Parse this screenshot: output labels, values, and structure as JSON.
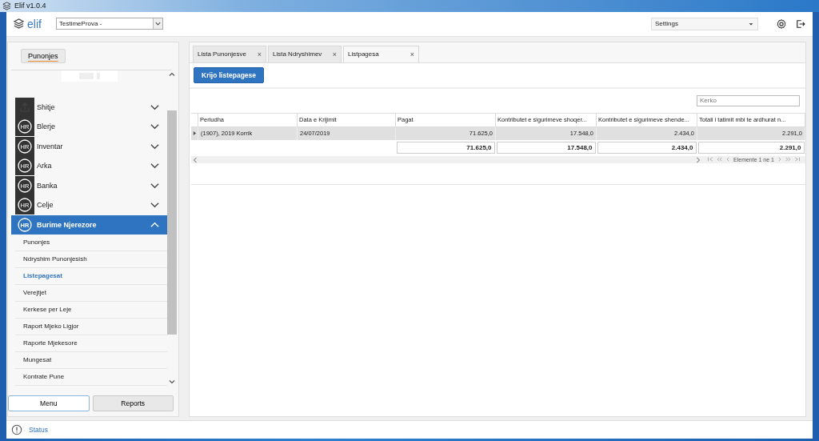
{
  "window": {
    "title": "Elif v1.0.4"
  },
  "header": {
    "logo": "elif",
    "company": "TestimeProva -",
    "settings": "Settings"
  },
  "sidebar": {
    "top_button": "Punonjes",
    "modules": [
      {
        "label": "Shitje",
        "kind": "upload",
        "expanded": false,
        "selected": false
      },
      {
        "label": "Blerje",
        "kind": "badge",
        "badge": "HR",
        "expanded": false,
        "selected": false
      },
      {
        "label": "Inventar",
        "kind": "badge",
        "badge": "HR",
        "expanded": false,
        "selected": false
      },
      {
        "label": "Arka",
        "kind": "badge",
        "badge": "HR",
        "expanded": false,
        "selected": false
      },
      {
        "label": "Banka",
        "kind": "badge",
        "badge": "HR",
        "expanded": false,
        "selected": false
      },
      {
        "label": "Celje",
        "kind": "badge",
        "badge": "HR",
        "expanded": false,
        "selected": false
      },
      {
        "label": "Burime Njerezore",
        "kind": "badge",
        "badge": "HR",
        "expanded": true,
        "selected": true,
        "children": [
          {
            "label": "Punonjes",
            "selected": false
          },
          {
            "label": "Ndryshim Punonjesish",
            "selected": false
          },
          {
            "label": "Listepagesat",
            "selected": true
          },
          {
            "label": "Verejtjet",
            "selected": false
          },
          {
            "label": "Kerkese per Leje",
            "selected": false
          },
          {
            "label": "Raport Mjeko Ligjor",
            "selected": false
          },
          {
            "label": "Raporte Mjekesore",
            "selected": false
          },
          {
            "label": "Mungesat",
            "selected": false
          },
          {
            "label": "Kontrate Pune",
            "selected": false
          }
        ]
      }
    ],
    "bottom_buttons": [
      {
        "label": "Menu",
        "selected": true
      },
      {
        "label": "Reports",
        "selected": false
      }
    ]
  },
  "tabs": [
    {
      "label": "Lista Punonjesve",
      "selected": false,
      "close": "×"
    },
    {
      "label": "Lista Ndryshimev",
      "selected": false,
      "close": "×"
    },
    {
      "label": "Listpagesa",
      "selected": true,
      "close": "×"
    }
  ],
  "create_button": "Krijo listepagese",
  "search": {
    "placeholder": "Kerko"
  },
  "table": {
    "columns": [
      "Periudha",
      "Data e Krijimit",
      "Pagat",
      "Kontributet e sigurimeve shoqer...",
      "Kontributet e sigurimeve shende...",
      "Totali i tatimit mbi te ardhurat n..."
    ],
    "rows": [
      {
        "cells": [
          "(1907), 2019 Korrik",
          "24/07/2019",
          "71.625,0",
          "17.548,0",
          "2.434,0",
          "2.291,0"
        ],
        "selected": true
      }
    ],
    "totals": [
      "71.625,0",
      "17.548,0",
      "2.434,0",
      "2.291,0"
    ],
    "pager": "Elemente 1 ne 1"
  },
  "status_bar": {
    "text": "Status"
  }
}
